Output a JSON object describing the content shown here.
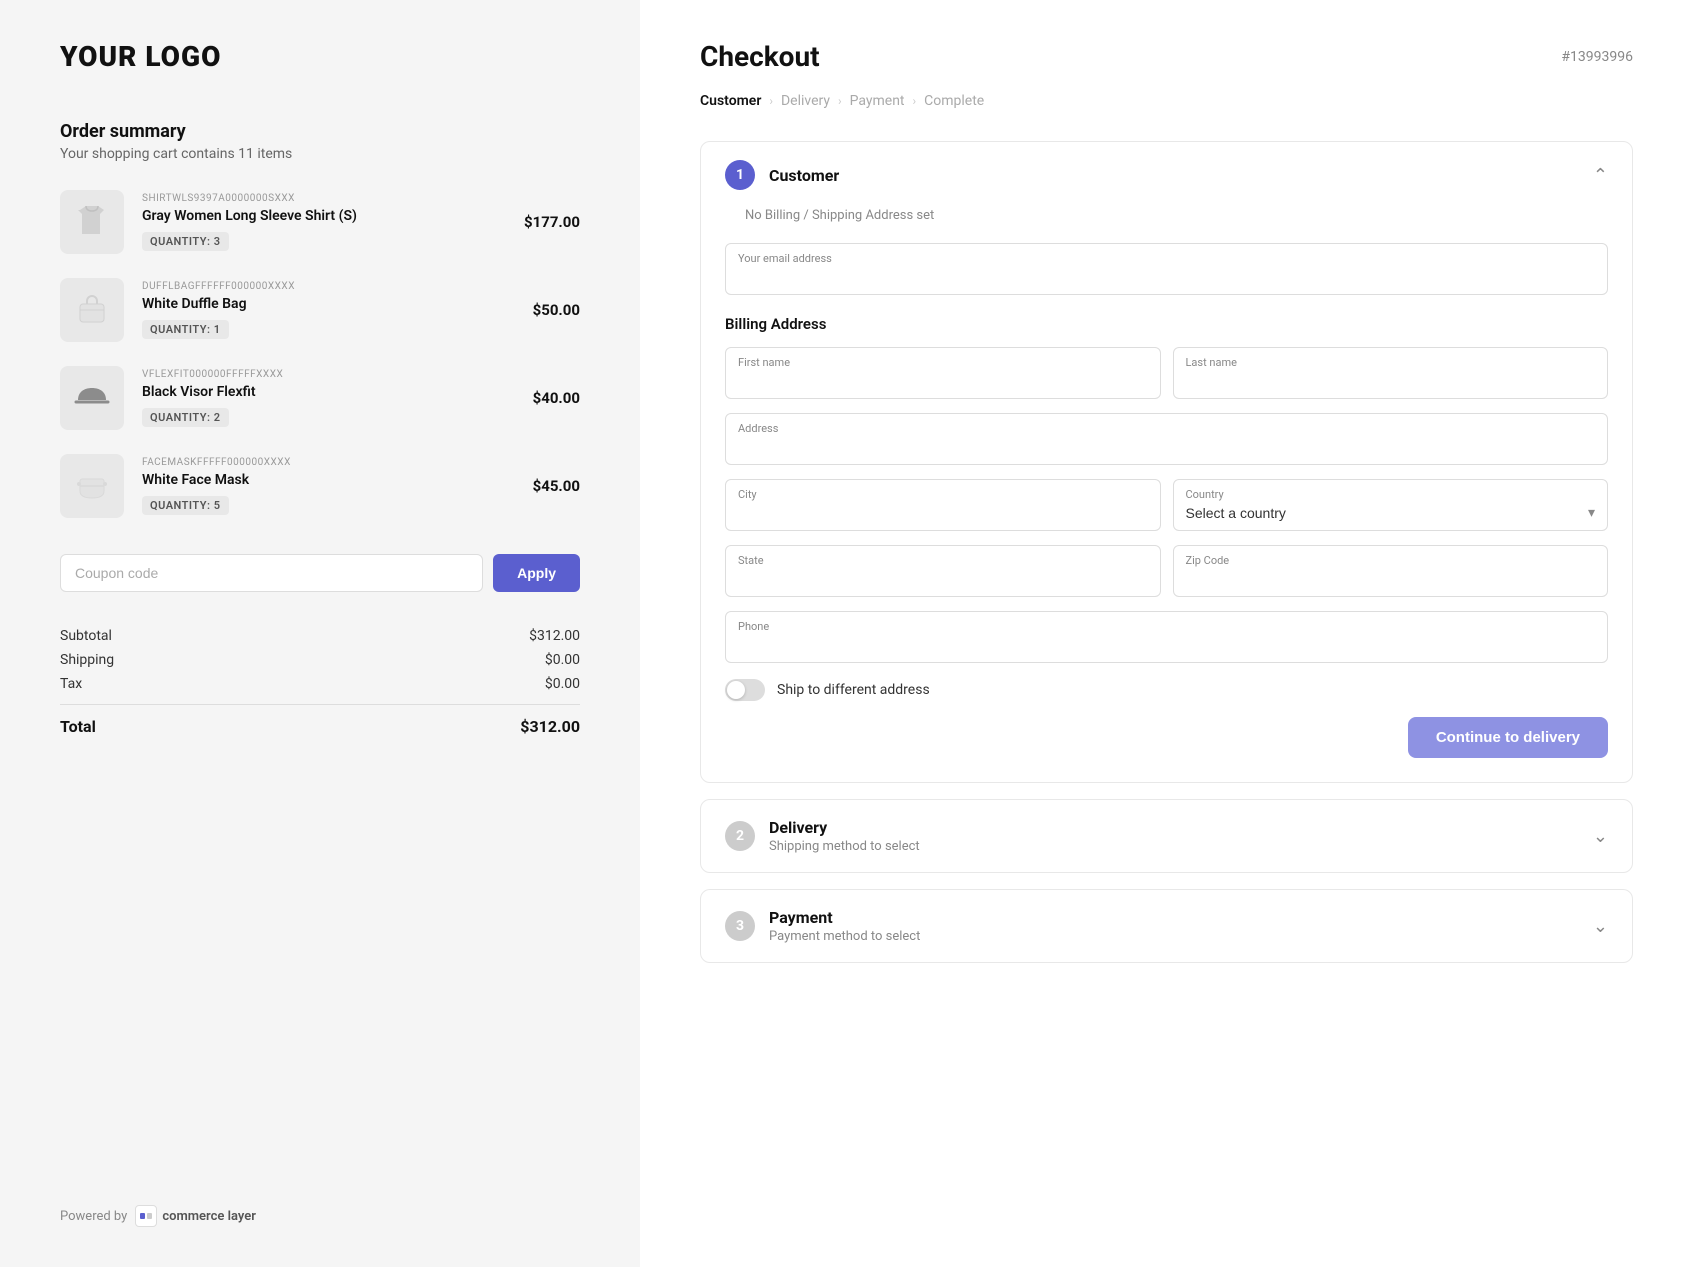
{
  "left": {
    "logo": "YOUR LOGO",
    "order_summary": {
      "title": "Order summary",
      "subtitle": "Your shopping cart contains 11 items"
    },
    "items": [
      {
        "sku": "SHIRTWLS9397A0000000SXXX",
        "name": "Gray Women Long Sleeve Shirt (S)",
        "quantity": "QUANTITY: 3",
        "price": "$177.00",
        "image_type": "shirt"
      },
      {
        "sku": "DUFFLBAGFFFFFF000000XXXX",
        "name": "White Duffle Bag",
        "quantity": "QUANTITY: 1",
        "price": "$50.00",
        "image_type": "bag"
      },
      {
        "sku": "VFLEXFIT000000FFFFFXXXX",
        "name": "Black Visor Flexfit",
        "quantity": "QUANTITY: 2",
        "price": "$40.00",
        "image_type": "visor"
      },
      {
        "sku": "FACEMASKFFFFF000000XXXX",
        "name": "White Face Mask",
        "quantity": "QUANTITY: 5",
        "price": "$45.00",
        "image_type": "mask"
      }
    ],
    "coupon": {
      "placeholder": "Coupon code",
      "apply_label": "Apply"
    },
    "totals": {
      "subtotal_label": "Subtotal",
      "subtotal_value": "$312.00",
      "shipping_label": "Shipping",
      "shipping_value": "$0.00",
      "tax_label": "Tax",
      "tax_value": "$0.00",
      "total_label": "Total",
      "total_value": "$312.00"
    },
    "powered_by": "Powered by",
    "powered_by_brand": "commerce layer"
  },
  "right": {
    "header": {
      "title": "Checkout",
      "order_number": "#13993996"
    },
    "breadcrumb": [
      {
        "label": "Customer",
        "state": "active"
      },
      {
        "label": "Delivery",
        "state": "inactive"
      },
      {
        "label": "Payment",
        "state": "inactive"
      },
      {
        "label": "Complete",
        "state": "inactive"
      }
    ],
    "steps": {
      "customer": {
        "number": "1",
        "title": "Customer",
        "subtitle": "No Billing / Shipping Address set",
        "email_label": "Your email address",
        "billing_address_label": "Billing Address",
        "fields": {
          "first_name": "First name",
          "last_name": "Last name",
          "address": "Address",
          "city": "City",
          "country": "Country",
          "country_placeholder": "Select a country",
          "state": "State",
          "zip_code": "Zip Code",
          "phone": "Phone"
        },
        "toggle_label": "Ship to different address",
        "continue_btn": "Continue to delivery"
      },
      "delivery": {
        "number": "2",
        "title": "Delivery",
        "subtitle": "Shipping method to select"
      },
      "payment": {
        "number": "3",
        "title": "Payment",
        "subtitle": "Payment method to select"
      }
    },
    "colors": {
      "accent": "#5b5fcf",
      "accent_light": "#7b7fdf"
    }
  }
}
